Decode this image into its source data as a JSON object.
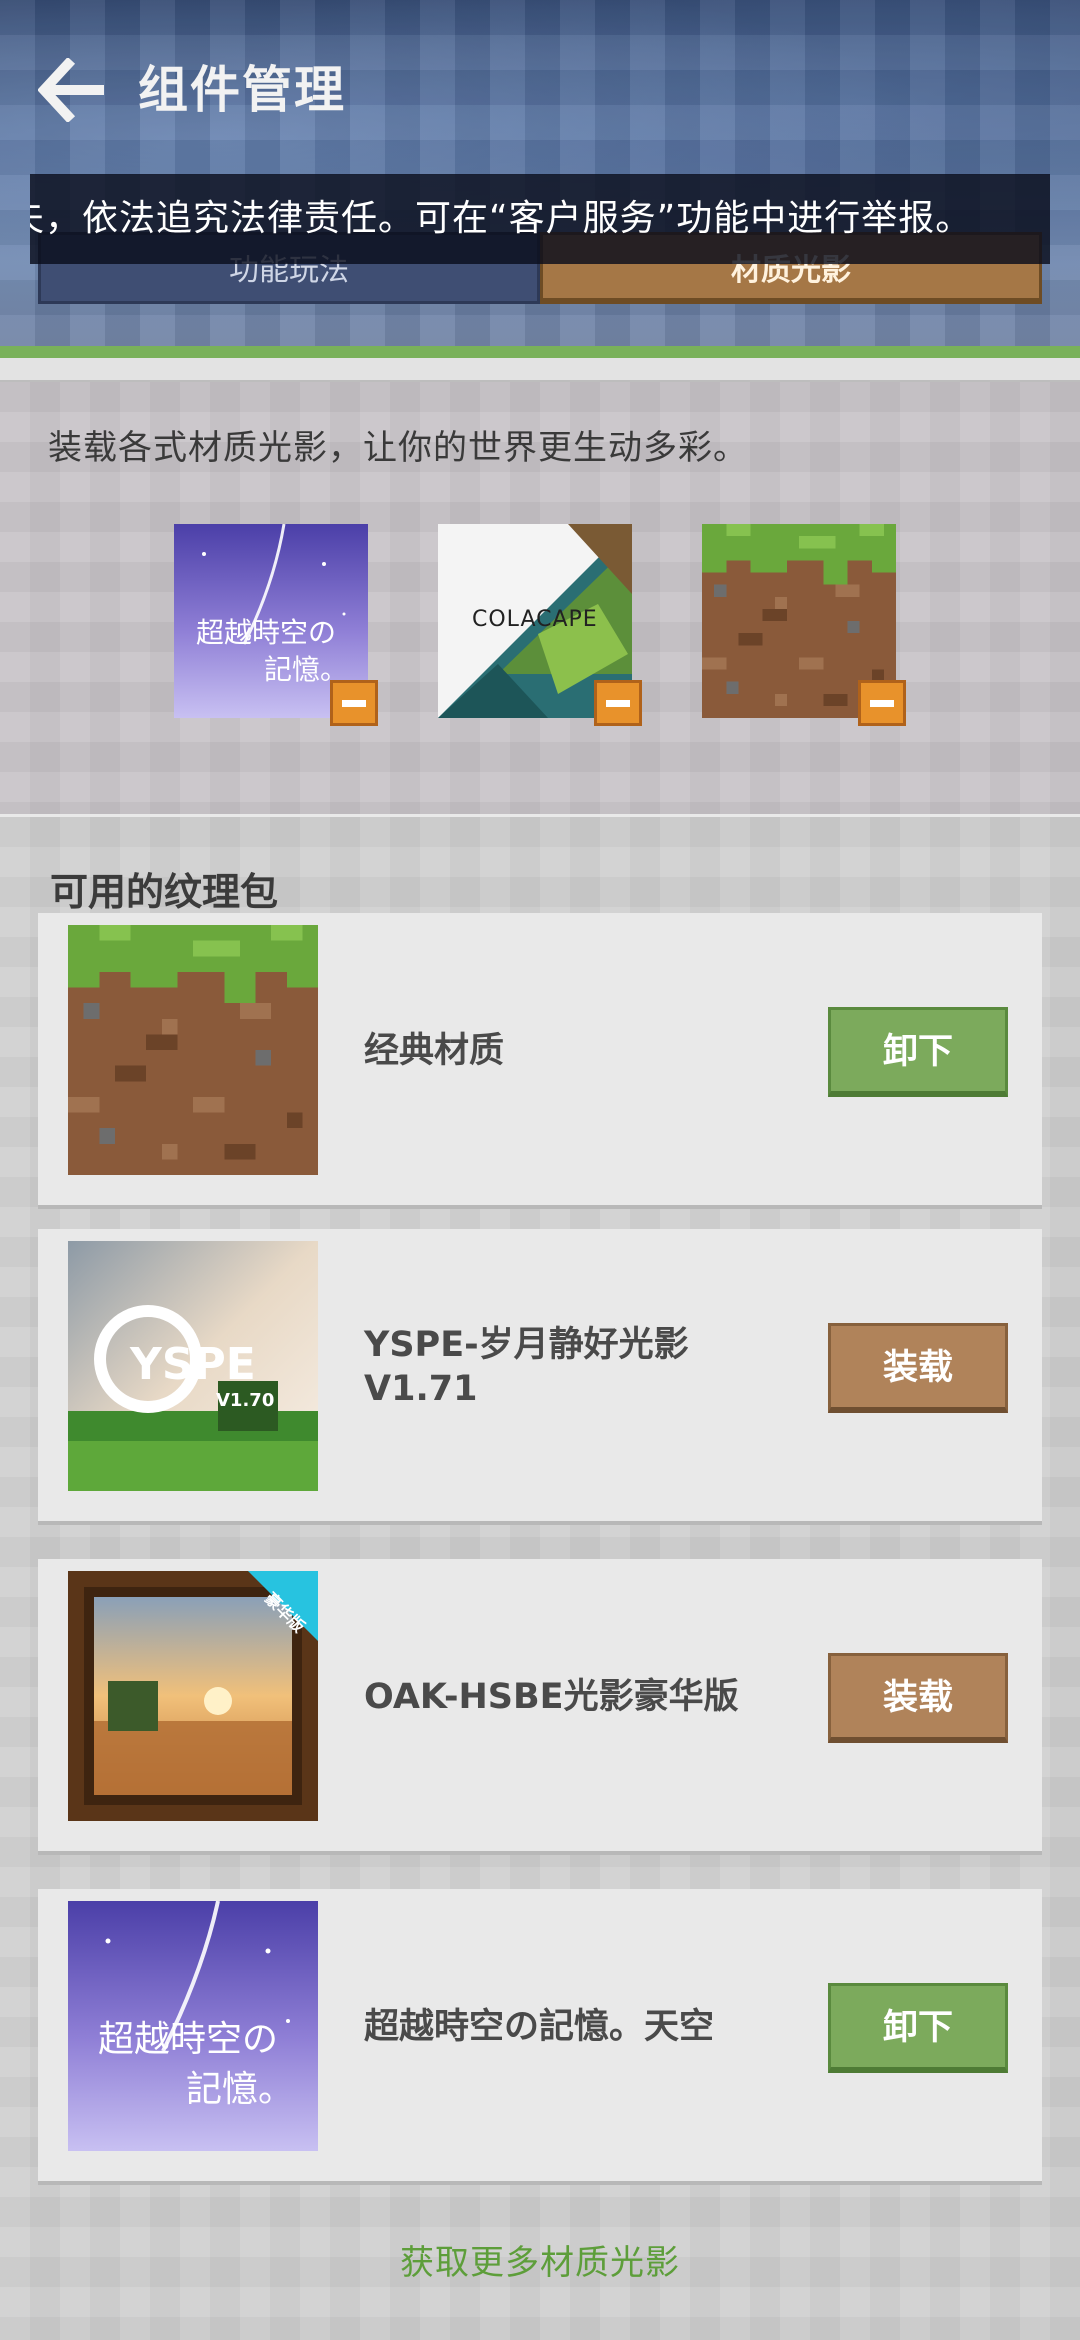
{
  "header": {
    "title": "组件管理",
    "back_icon": "arrow-left-icon"
  },
  "notice": {
    "text": "夫，依法追究法律责任。可在“客户服务”功能中进行举报。"
  },
  "tabs": [
    {
      "label": "功能玩法",
      "active": false
    },
    {
      "label": "材质光影",
      "active": true
    }
  ],
  "equipped": {
    "description": "装载各式材质光影，让你的世界更生动多彩。",
    "items": [
      {
        "name": "超越時空の記憶",
        "thumb_text_1": "超越時空の",
        "thumb_text_2": "記憶。",
        "remove_icon": "minus-icon"
      },
      {
        "name": "COLACAPE",
        "thumb_text": "COLACAPE",
        "remove_icon": "minus-icon"
      },
      {
        "name": "经典材质",
        "remove_icon": "minus-icon"
      }
    ]
  },
  "available": {
    "title": "可用的纹理包",
    "packs": [
      {
        "name": "经典材质",
        "button": "卸下",
        "state": "installed"
      },
      {
        "name": "YSPE-岁月静好光影V1.71",
        "button": "装载",
        "state": "available",
        "thumb_text": "YSPE",
        "thumb_version": "V1.70"
      },
      {
        "name": "OAK-HSBE光影豪华版",
        "button": "装载",
        "state": "available",
        "ribbon": "豪华版"
      },
      {
        "name": "超越時空の記憶。天空",
        "button": "卸下",
        "state": "installed",
        "thumb_text_1": "超越時空の",
        "thumb_text_2": "記憶。"
      }
    ],
    "more_link": "获取更多材质光影"
  },
  "colors": {
    "install_button": "#7caa5c",
    "equip_button": "#b0835a",
    "remove_badge": "#e8922b",
    "link": "#5d9e3a"
  }
}
